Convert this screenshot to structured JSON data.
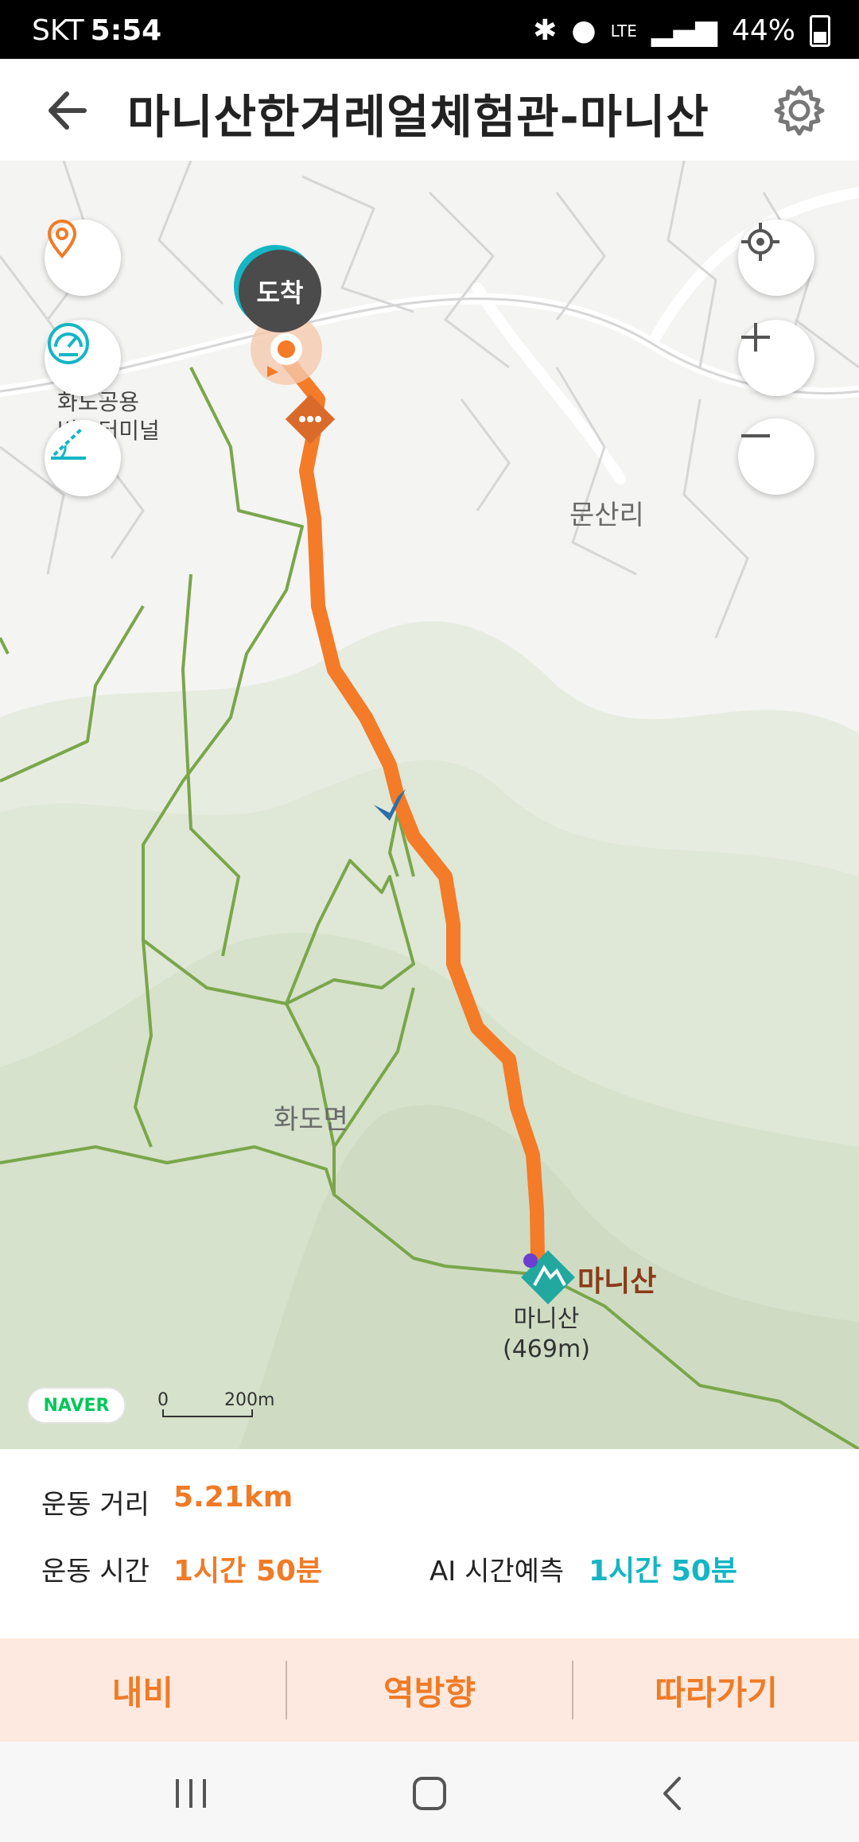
{
  "status": {
    "carrier": "SKT",
    "time": "5:54",
    "battery": "44%",
    "network": "LTE"
  },
  "header": {
    "title": "마니산한겨레얼체험관-마니산"
  },
  "map": {
    "labels": {
      "terminal_line1": "화도공용",
      "terminal_line2": "버스터미널",
      "village": "문산리",
      "district": "화도면",
      "peak_name": "마니산",
      "peak_sub": "마니산",
      "peak_elev": "(469m)",
      "arrival_badge": "도착"
    },
    "scale": {
      "start": "0",
      "end": "200m"
    },
    "brand": "NAVER"
  },
  "stats": {
    "distance_label": "운동 거리",
    "distance_value": "5.21km",
    "time_label": "운동 시간",
    "time_value": "1시간 50분",
    "ai_label": "AI 시간예측",
    "ai_value": "1시간 50분"
  },
  "actions": {
    "navi": "내비",
    "reverse": "역방향",
    "follow": "따라가기"
  },
  "colors": {
    "route": "#f47b27",
    "trail": "#7aa64a",
    "accent_cyan": "#15b5c4",
    "accent_orange": "#f07b27"
  },
  "icons": [
    "back-arrow-icon",
    "gear-icon",
    "location-pin-icon",
    "speedometer-icon",
    "slope-icon",
    "my-location-icon",
    "zoom-in-icon",
    "zoom-out-icon",
    "mountain-icon"
  ]
}
